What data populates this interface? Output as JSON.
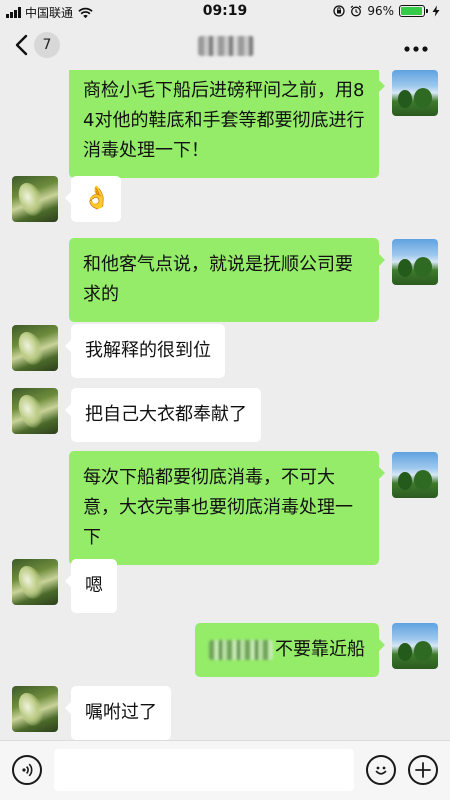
{
  "status_bar": {
    "carrier": "中国联通",
    "time": "09:19",
    "battery": "96%",
    "battery_level": 0.96
  },
  "nav": {
    "unread_count": "7"
  },
  "messages": [
    {
      "side": "out",
      "text": "商检小毛下船后进磅秤间之前，用84对他的鞋底和手套等都要彻底进行消毒处理一下！"
    },
    {
      "side": "in",
      "emoji": "👌"
    },
    {
      "side": "out",
      "text": "和他客气点说，就说是抚顺公司要求的"
    },
    {
      "side": "in",
      "text": "我解释的很到位"
    },
    {
      "side": "in",
      "text": "把自己大衣都奉献了"
    },
    {
      "side": "out",
      "text": "每次下船都要彻底消毒，不可大意，大衣完事也要彻底消毒处理一下"
    },
    {
      "side": "in",
      "text": "嗯"
    },
    {
      "side": "out",
      "text": "不要靠近船"
    },
    {
      "side": "in",
      "text": "嘱咐过了"
    }
  ],
  "input": {
    "value": ""
  },
  "icons": {
    "back": "chevron-left-icon",
    "more": "more-dots-icon",
    "voice": "voice-icon",
    "emoji": "emoji-icon",
    "plus": "plus-icon"
  },
  "colors": {
    "background": "#ededed",
    "outgoing_bubble": "#95ec69",
    "incoming_bubble": "#ffffff"
  }
}
